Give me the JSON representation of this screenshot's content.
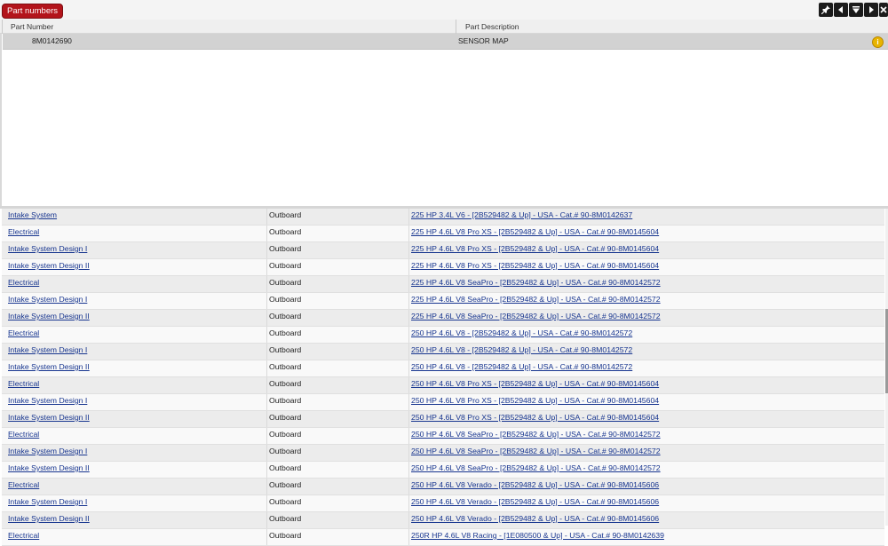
{
  "header": {
    "tab_label": "Part numbers",
    "toolbar": [
      {
        "name": "pin-icon"
      },
      {
        "name": "arrow-left-icon"
      },
      {
        "name": "filter-icon"
      },
      {
        "name": "arrow-right-icon"
      },
      {
        "name": "close-icon"
      }
    ]
  },
  "parts_table": {
    "columns": [
      "Part Number",
      "Part Description"
    ],
    "rows": [
      {
        "part_number": "8M0142690",
        "description": "SENSOR MAP",
        "icon": "info-icon"
      }
    ]
  },
  "applications": [
    {
      "group": "Intake System",
      "type": "Outboard",
      "model": "225 HP 3.4L V6 - [2B529482 & Up] - USA - Cat.# 90-8M0142637"
    },
    {
      "group": "Electrical",
      "type": "Outboard",
      "model": "225 HP 4.6L V8 Pro XS - [2B529482 & Up] - USA - Cat.# 90-8M0145604"
    },
    {
      "group": "Intake System Design I",
      "type": "Outboard",
      "model": "225 HP 4.6L V8 Pro XS - [2B529482 & Up] - USA - Cat.# 90-8M0145604"
    },
    {
      "group": "Intake System Design II",
      "type": "Outboard",
      "model": "225 HP 4.6L V8 Pro XS - [2B529482 & Up] - USA - Cat.# 90-8M0145604"
    },
    {
      "group": "Electrical",
      "type": "Outboard",
      "model": "225 HP 4.6L V8 SeaPro - [2B529482 & Up] - USA - Cat.# 90-8M0142572"
    },
    {
      "group": "Intake System Design I",
      "type": "Outboard",
      "model": "225 HP 4.6L V8 SeaPro - [2B529482 & Up] - USA - Cat.# 90-8M0142572"
    },
    {
      "group": "Intake System Design II",
      "type": "Outboard",
      "model": "225 HP 4.6L V8 SeaPro - [2B529482 & Up] - USA - Cat.# 90-8M0142572"
    },
    {
      "group": "Electrical",
      "type": "Outboard",
      "model": "250 HP 4.6L V8 - [2B529482 & Up] - USA - Cat.# 90-8M0142572"
    },
    {
      "group": "Intake System Design I",
      "type": "Outboard",
      "model": "250 HP 4.6L V8 - [2B529482 & Up] - USA - Cat.# 90-8M0142572"
    },
    {
      "group": "Intake System Design II",
      "type": "Outboard",
      "model": "250 HP 4.6L V8 - [2B529482 & Up] - USA - Cat.# 90-8M0142572"
    },
    {
      "group": "Electrical",
      "type": "Outboard",
      "model": "250 HP 4.6L V8 Pro XS - [2B529482 & Up] - USA - Cat.# 90-8M0145604"
    },
    {
      "group": "Intake System Design I",
      "type": "Outboard",
      "model": "250 HP 4.6L V8 Pro XS - [2B529482 & Up] - USA - Cat.# 90-8M0145604"
    },
    {
      "group": "Intake System Design II",
      "type": "Outboard",
      "model": "250 HP 4.6L V8 Pro XS - [2B529482 & Up] - USA - Cat.# 90-8M0145604"
    },
    {
      "group": "Electrical",
      "type": "Outboard",
      "model": "250 HP 4.6L V8 SeaPro - [2B529482 & Up] - USA - Cat.# 90-8M0142572"
    },
    {
      "group": "Intake System Design I",
      "type": "Outboard",
      "model": "250 HP 4.6L V8 SeaPro - [2B529482 & Up] - USA - Cat.# 90-8M0142572"
    },
    {
      "group": "Intake System Design II",
      "type": "Outboard",
      "model": "250 HP 4.6L V8 SeaPro - [2B529482 & Up] - USA - Cat.# 90-8M0142572"
    },
    {
      "group": "Electrical",
      "type": "Outboard",
      "model": "250 HP 4.6L V8 Verado - [2B529482 & Up] - USA - Cat.# 90-8M0145606"
    },
    {
      "group": "Intake System Design I",
      "type": "Outboard",
      "model": "250 HP 4.6L V8 Verado - [2B529482 & Up] - USA - Cat.# 90-8M0145606"
    },
    {
      "group": "Intake System Design II",
      "type": "Outboard",
      "model": "250 HP 4.6L V8 Verado - [2B529482 & Up] - USA - Cat.# 90-8M0145606"
    },
    {
      "group": "Electrical",
      "type": "Outboard",
      "model": "250R HP 4.6L V8 Racing - [1E080500 & Up] - USA - Cat.# 90-8M0142639"
    }
  ]
}
